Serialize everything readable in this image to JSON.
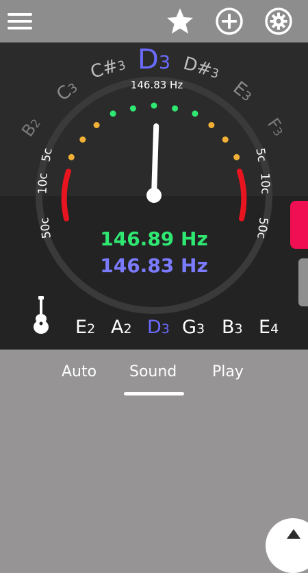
{
  "toolbar": {
    "menu_icon": "hamburger-menu-icon",
    "star_icon": "star-icon",
    "add_icon": "plus-circle-icon",
    "settings_icon": "gear-icon"
  },
  "tuner": {
    "target_note": {
      "letter": "D",
      "octave": "3"
    },
    "target_freq": "146.83 Hz",
    "neighbor_notes": [
      {
        "letter": "B",
        "octave": "2"
      },
      {
        "letter": "C",
        "octave": "3"
      },
      {
        "letter": "C#",
        "octave": "3"
      },
      {
        "letter": "D#",
        "octave": "3"
      },
      {
        "letter": "E",
        "octave": "3"
      },
      {
        "letter": "F",
        "octave": "3"
      }
    ],
    "cent_labels": {
      "c5": "5c",
      "c10": "10c",
      "c50": "50c"
    },
    "measured_freq": "146.89 Hz",
    "reference_freq": "146.83 Hz",
    "needle_cents": 1,
    "colors": {
      "green": "#2ee872",
      "orange": "#f2b136",
      "red": "#e8141f",
      "blue": "#6b6bff"
    }
  },
  "strings": [
    {
      "letter": "E",
      "octave": "2",
      "active": false
    },
    {
      "letter": "A",
      "octave": "2",
      "active": false
    },
    {
      "letter": "D",
      "octave": "3",
      "active": true
    },
    {
      "letter": "G",
      "octave": "3",
      "active": false
    },
    {
      "letter": "B",
      "octave": "3",
      "active": false
    },
    {
      "letter": "E",
      "octave": "4",
      "active": false
    }
  ],
  "tabs": [
    {
      "label": "Auto"
    },
    {
      "label": "Sound"
    },
    {
      "label": "Play"
    }
  ],
  "active_tab": "Sound"
}
